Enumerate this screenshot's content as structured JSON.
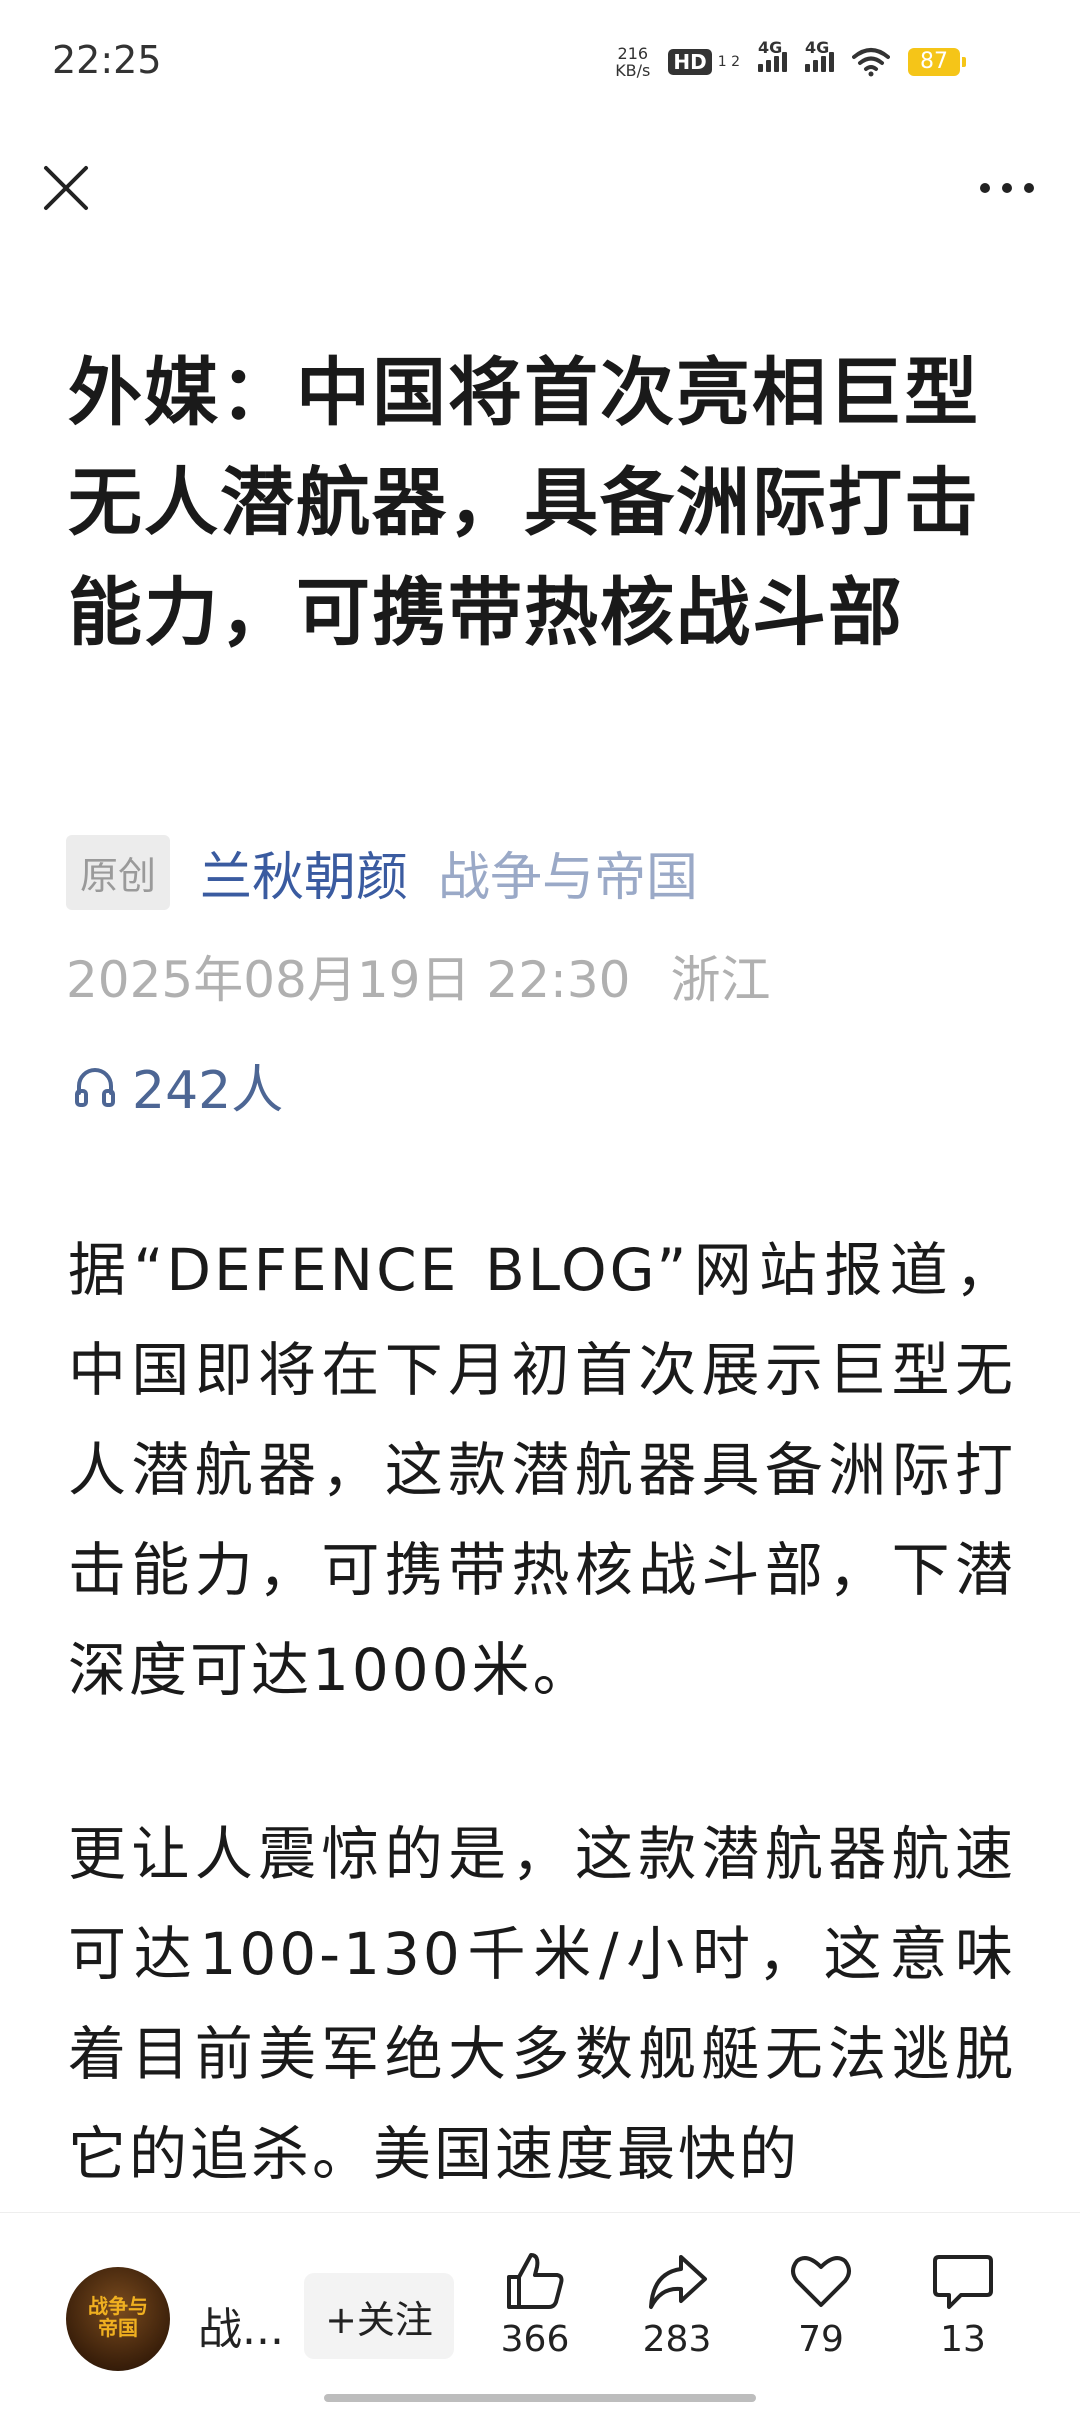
{
  "status_bar": {
    "time": "22:25",
    "net_speed_value": "216",
    "net_speed_unit": "KB/s",
    "hd_label": "HD",
    "hd_sub": "1 2",
    "signal1_label": "4G",
    "signal2_label": "4G",
    "battery": "87"
  },
  "nav": {
    "close_icon": "close-icon",
    "more_icon": "more-icon"
  },
  "article": {
    "title": "外媒：中国将首次亮相巨型无人潜航器，具备洲际打击能力，可携带热核战斗部",
    "original_badge": "原创",
    "author": "兰秋朝颜",
    "channel": "战争与帝国",
    "date": "2025年08月19日 22:30",
    "location": "浙江",
    "listeners": "242人",
    "paragraphs": [
      "据“DEFENCE BLOG”网站报道，中国即将在下月初首次展示巨型无人潜航器，这款潜航器具备洲际打击能力，可携带热核战斗部，下潜深度可达1000米。",
      "更让人震惊的是，这款潜航器航速可达100-130千米/小时，这意味着目前美军绝大多数舰艇无法逃脱它的追杀。美国速度最快的"
    ]
  },
  "bottom_bar": {
    "avatar_text_line1": "战争与",
    "avatar_text_line2": "帝国",
    "channel_short": "战...",
    "follow_label": "+关注",
    "like_count": "366",
    "share_count": "283",
    "favorite_count": "79",
    "comment_count": "13"
  },
  "colors": {
    "author_blue": "#3a5ba0",
    "channel_blue": "#9aa9c7",
    "battery_yellow": "#f5c518"
  }
}
